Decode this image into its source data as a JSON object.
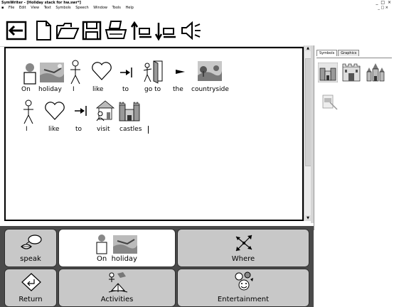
{
  "window": {
    "title": "SymWriter - [Holiday stack for hw.swr*]",
    "controls": "_ □ ×",
    "doc_controls": "_ □ ×"
  },
  "menu": [
    "File",
    "Edit",
    "View",
    "Text",
    "Symbols",
    "Speech",
    "Window",
    "Tools",
    "Help"
  ],
  "toolbar": [
    "back-arrow-icon",
    "new-document-icon",
    "open-folder-icon",
    "save-disk-icon",
    "print-icon",
    "sort-up-icon",
    "sort-down-icon",
    "speaker-icon"
  ],
  "document": {
    "line1": [
      "On",
      "holiday",
      "I",
      "like",
      "to",
      "go to",
      "the",
      "countryside"
    ],
    "line2": [
      "I",
      "like",
      "to",
      "visit",
      "castles"
    ]
  },
  "side_panel": {
    "tabs": [
      "Symbols",
      "Graphics"
    ],
    "active_tab": "Symbols"
  },
  "grid": {
    "cells": [
      {
        "label": "speak",
        "icon": "speak-lips-icon"
      },
      {
        "label": "On  holiday",
        "icon": "on-holiday-icon"
      },
      {
        "label": "Where",
        "icon": "where-arrows-icon"
      },
      {
        "label": "Return",
        "icon": "return-icon"
      },
      {
        "label": "Activities",
        "icon": "activities-icon"
      },
      {
        "label": "Entertainment",
        "icon": "entertainment-icon"
      }
    ]
  }
}
